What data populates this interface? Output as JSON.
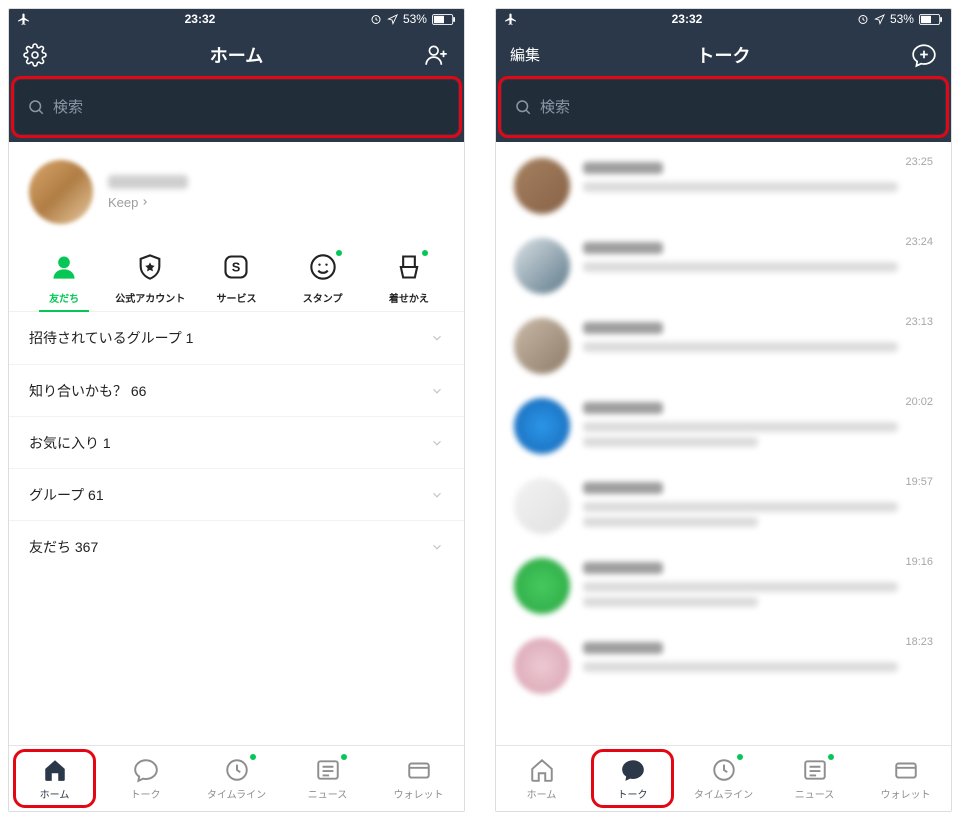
{
  "statusbar": {
    "time": "23:32",
    "battery": "53%"
  },
  "left": {
    "title": "ホーム",
    "search_placeholder": "検索",
    "profile": {
      "keep_label": "Keep"
    },
    "cats": [
      {
        "label": "友だち",
        "active": true,
        "dot": false
      },
      {
        "label": "公式アカウント",
        "active": false,
        "dot": false
      },
      {
        "label": "サービス",
        "active": false,
        "dot": false
      },
      {
        "label": "スタンプ",
        "active": false,
        "dot": true
      },
      {
        "label": "着せかえ",
        "active": false,
        "dot": true
      }
    ],
    "rows": [
      {
        "label": "招待されているグループ 1"
      },
      {
        "label": "知り合いかも？ 66"
      },
      {
        "label": "お気に入り 1"
      },
      {
        "label": "グループ 61"
      },
      {
        "label": "友だち 367"
      }
    ]
  },
  "right": {
    "edit_label": "編集",
    "title": "トーク",
    "search_placeholder": "検索",
    "talks": [
      {
        "time": "23:25",
        "color": "linear-gradient(135deg,#a5805f,#876247)"
      },
      {
        "time": "23:24",
        "color": "linear-gradient(135deg,#d9e0e4,#5e7a8a)"
      },
      {
        "time": "23:13",
        "color": "linear-gradient(135deg,#c9b9a7,#8d7c68)"
      },
      {
        "time": "20:02",
        "color": "radial-gradient(circle,#2b96e8,#1766b5)"
      },
      {
        "time": "19:57",
        "color": "linear-gradient(135deg,#f3f3f3,#e0e0e0)"
      },
      {
        "time": "19:16",
        "color": "radial-gradient(circle,#47c95f,#2aa641)"
      },
      {
        "time": "18:23",
        "color": "radial-gradient(circle,#ecc9d2,#d8a2b1)"
      }
    ]
  },
  "tabs": [
    {
      "label": "ホーム"
    },
    {
      "label": "トーク"
    },
    {
      "label": "タイムライン"
    },
    {
      "label": "ニュース"
    },
    {
      "label": "ウォレット"
    }
  ]
}
